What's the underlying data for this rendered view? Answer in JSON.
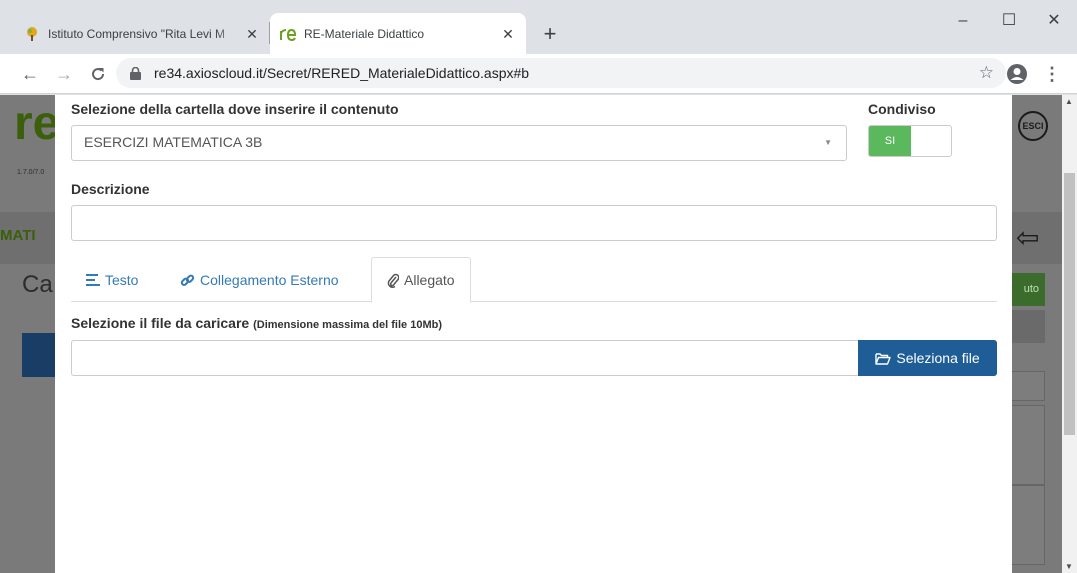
{
  "browser": {
    "tabs": [
      {
        "title": "Istituto Comprensivo \"Rita Levi M",
        "active": false
      },
      {
        "title": "RE-Materiale Didattico",
        "active": true
      }
    ],
    "new_tab": "+",
    "url": "re34.axioscloud.it/Secret/RERED_MaterialeDidattico.aspx#b",
    "window_buttons": {
      "minimize": "–",
      "maximize": "☐",
      "close": "✕"
    }
  },
  "background_page": {
    "logo": "re",
    "version": "1.7.0/7.0",
    "section_label": "MATI",
    "heading_fragment": "Ca",
    "esci_label": "ESCI",
    "green_button_fragment": "uto",
    "colors": {
      "logo_green": "#3b5f0a",
      "overlay": "#7a7a7a"
    }
  },
  "modal": {
    "folder_label": "Selezione della cartella dove inserire il contenuto",
    "folder_value": "ESERCIZI MATEMATICA 3B",
    "shared_label": "Condiviso",
    "shared_on_label": "SI",
    "shared_state": true,
    "description_label": "Descrizione",
    "description_value": "",
    "tabs": [
      {
        "label": "Testo",
        "icon": "align-left-icon",
        "active": false
      },
      {
        "label": "Collegamento Esterno",
        "icon": "link-icon",
        "active": false
      },
      {
        "label": "Allegato",
        "icon": "paperclip-icon",
        "active": true
      }
    ],
    "file_label": "Selezione il file da caricare",
    "file_hint": "(Dimensione massima del file 10Mb)",
    "file_value": "",
    "file_button": "Seleziona file",
    "colors": {
      "accent": "#337ab7",
      "toggle_on": "#5cb85c",
      "button": "#1f5d96"
    }
  }
}
